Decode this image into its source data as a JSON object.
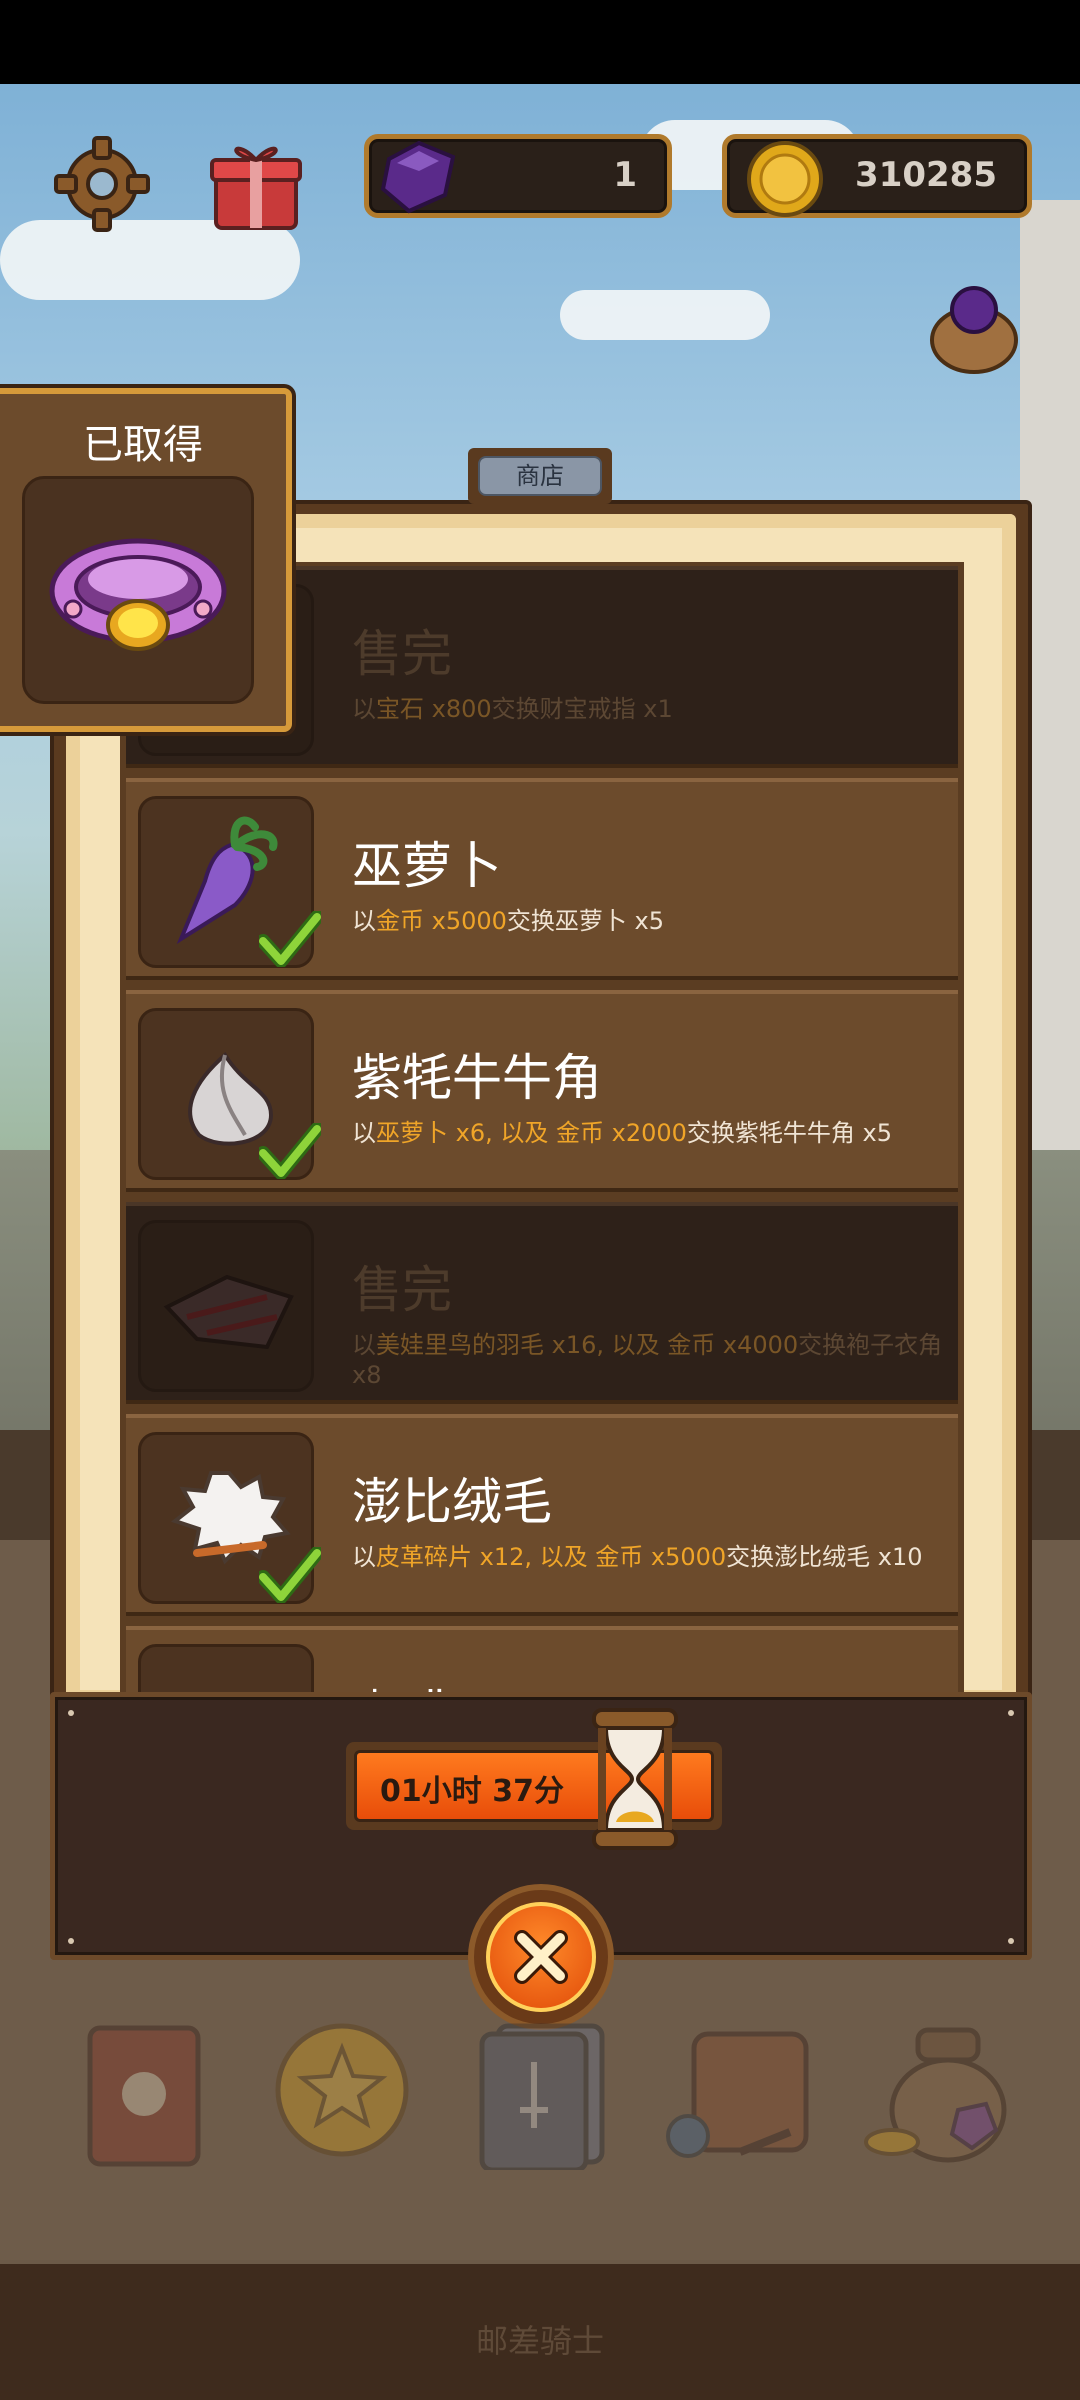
{
  "hud": {
    "gems": "1",
    "coins": "310285",
    "settings_icon": "gear-icon",
    "gift_icon": "gift-icon"
  },
  "obtained": {
    "title": "已取得",
    "item_icon": "treasure-ring-icon"
  },
  "shop": {
    "tab_label": "商店",
    "rows": [
      {
        "title": "售完",
        "desc_pre": "以",
        "desc_hl1": "宝石 x800",
        "desc_mid": "交换财宝戒指 x1",
        "desc_hl2": "",
        "desc_post": "",
        "sold_out": true,
        "icon": "ring-icon"
      },
      {
        "title": "巫萝卜",
        "desc_pre": "以",
        "desc_hl1": "金币 x5000",
        "desc_mid": "交换巫萝卜 x5",
        "desc_hl2": "",
        "desc_post": "",
        "sold_out": false,
        "icon": "purple-radish-icon"
      },
      {
        "title": "紫牦牛牛角",
        "desc_pre": "以",
        "desc_hl1": "巫萝卜 x6, 以及 金币 x2000",
        "desc_mid": "交换紫牦牛牛角 x5",
        "desc_hl2": "",
        "desc_post": "",
        "sold_out": false,
        "icon": "horn-icon"
      },
      {
        "title": "售完",
        "desc_pre": "以",
        "desc_hl1": "美娃里鸟的羽毛 x16, 以及 金币 x4000",
        "desc_mid": "交换袍子衣角 x8",
        "desc_hl2": "",
        "desc_post": "",
        "sold_out": true,
        "icon": "cloth-scrap-icon"
      },
      {
        "title": "澎比绒毛",
        "desc_pre": "以",
        "desc_hl1": "皮革碎片 x12, 以及 金币 x5000",
        "desc_mid": "交换澎比绒毛 x10",
        "desc_hl2": "",
        "desc_post": "",
        "sold_out": false,
        "icon": "fluff-icon"
      },
      {
        "title": "咖啡",
        "desc_pre": "",
        "desc_hl1": "",
        "desc_mid": "",
        "desc_hl2": "",
        "desc_post": "",
        "sold_out": false,
        "icon": "coffee-icon"
      }
    ]
  },
  "timer": {
    "text": "01小时 37分",
    "icon": "hourglass-icon"
  },
  "close_icon": "close-icon",
  "bottom_nav": [
    "book-icon",
    "star-coin-icon",
    "card-deck-icon",
    "backpack-icon",
    "loot-bag-icon"
  ],
  "footer": {
    "label": "邮差骑士"
  },
  "colors": {
    "highlight": "#f0a528",
    "panel_brown": "#6c4b2c",
    "parchment": "#f5e3b9",
    "timer_orange": "#ff7a1e"
  }
}
